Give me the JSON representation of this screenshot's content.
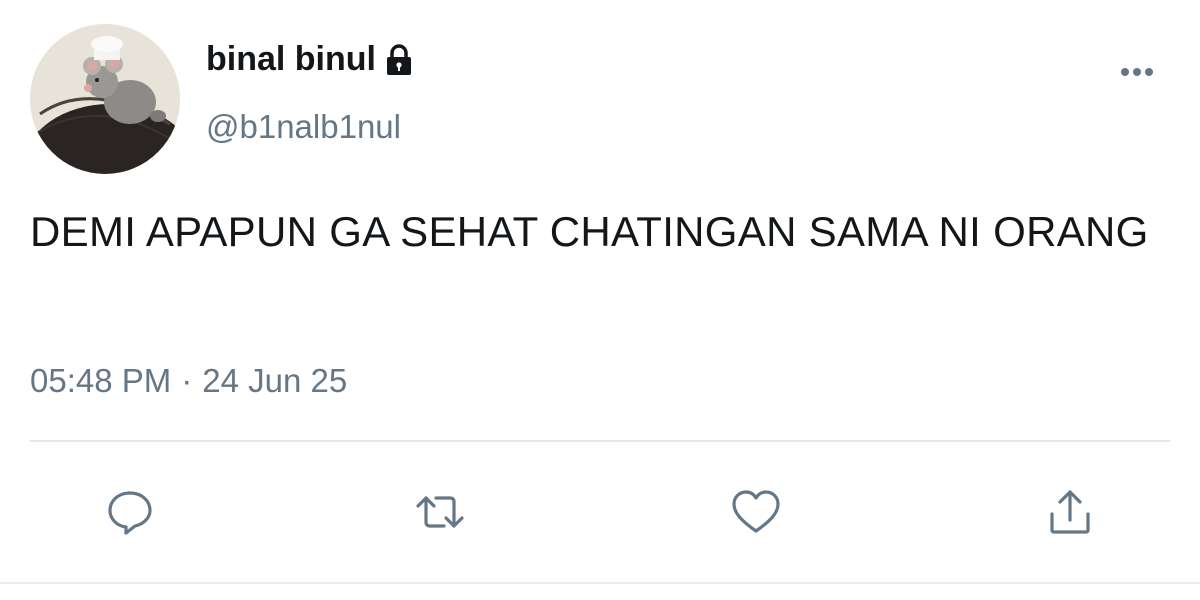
{
  "user": {
    "display_name": "binal binul",
    "handle": "@b1nalb1nul",
    "avatar_icon": "avatar-plush-rat-photo",
    "protected_icon": "lock-icon"
  },
  "tweet": {
    "text": "DEMI APAPUN GA SEHAT CHATINGAN SAMA NI ORANG",
    "time": "05:48 PM",
    "separator": "·",
    "date": "24 Jun 25"
  },
  "actions": [
    {
      "name": "reply",
      "icon": "reply-icon"
    },
    {
      "name": "retweet",
      "icon": "retweet-icon"
    },
    {
      "name": "like",
      "icon": "heart-icon"
    },
    {
      "name": "share",
      "icon": "share-icon"
    }
  ],
  "colors": {
    "text_primary": "#14171a",
    "text_secondary": "#657786",
    "icon": "#657786",
    "divider": "#e1e8ed"
  }
}
